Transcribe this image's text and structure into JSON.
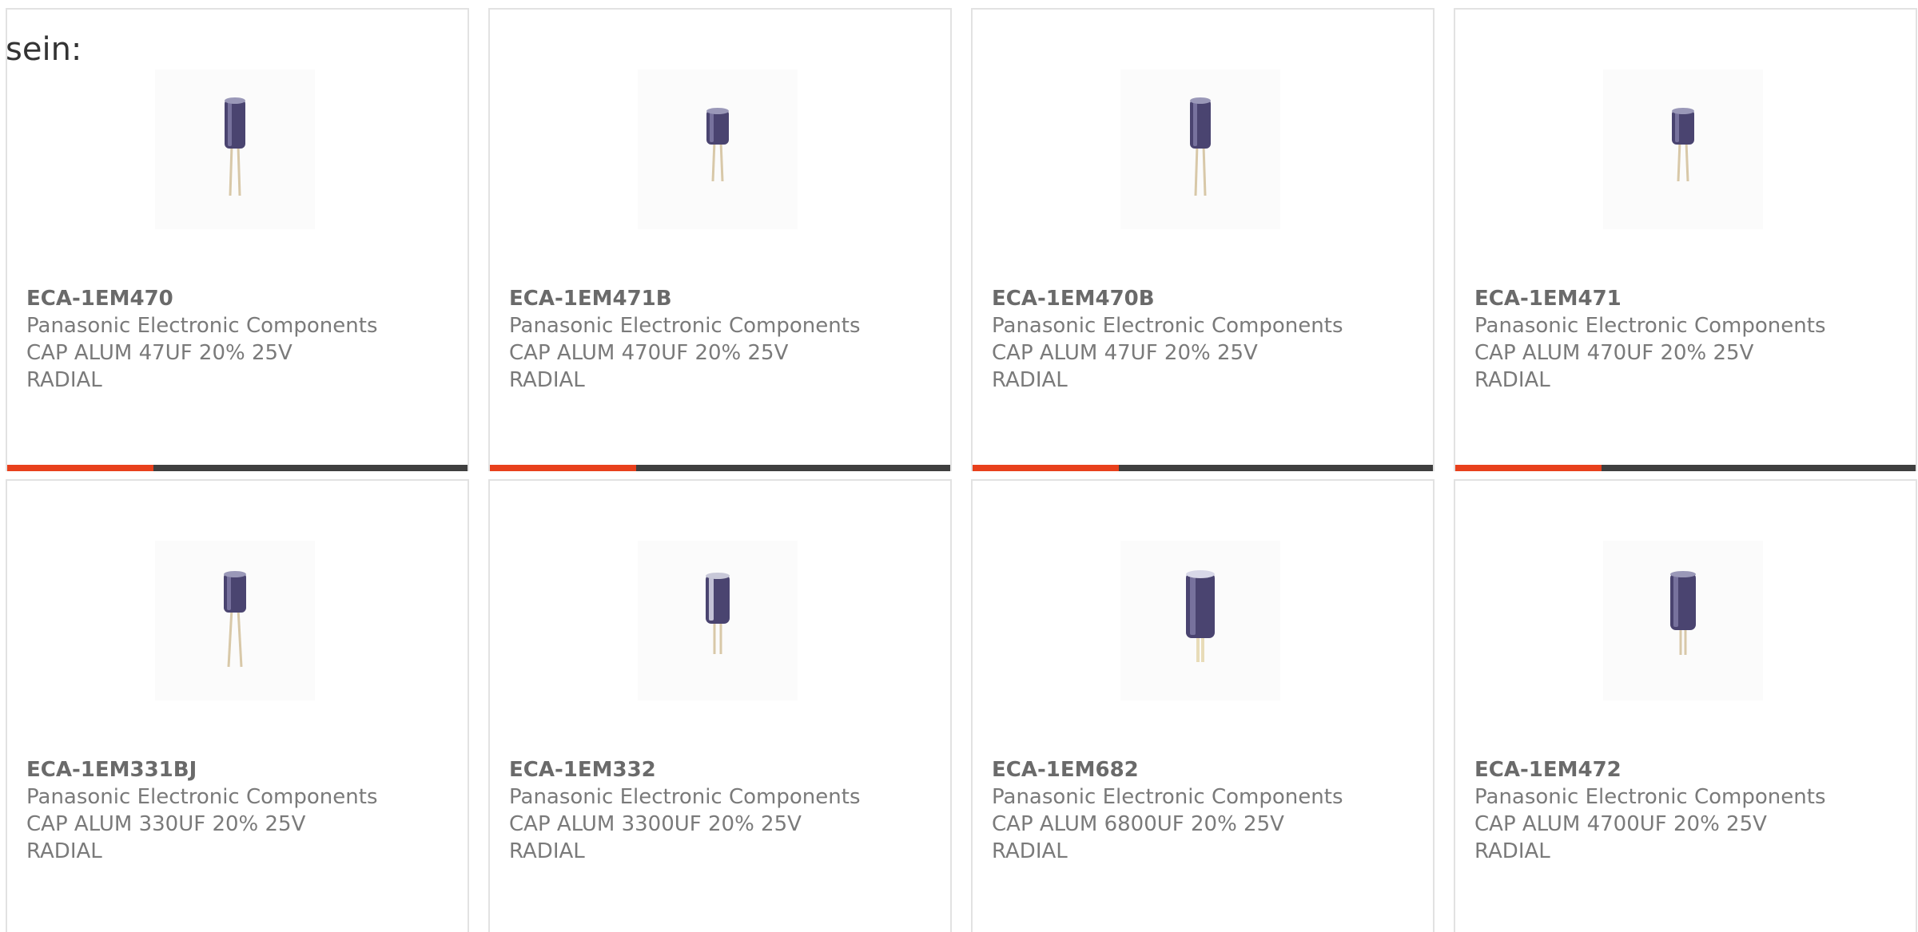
{
  "heading": "sein:",
  "accent_color": "#e8401c",
  "bar_color": "#3f3f3f",
  "cards": [
    {
      "part": "ECA-1EM470",
      "manufacturer": "Panasonic Electronic Components",
      "desc": "CAP ALUM 47UF 20% 25V",
      "mount": "RADIAL",
      "icon": "capacitor-icon"
    },
    {
      "part": "ECA-1EM471B",
      "manufacturer": "Panasonic Electronic Components",
      "desc": "CAP ALUM 470UF 20% 25V",
      "mount": "RADIAL",
      "icon": "capacitor-icon"
    },
    {
      "part": "ECA-1EM470B",
      "manufacturer": "Panasonic Electronic Components",
      "desc": "CAP ALUM 47UF 20% 25V",
      "mount": "RADIAL",
      "icon": "capacitor-icon"
    },
    {
      "part": "ECA-1EM471",
      "manufacturer": "Panasonic Electronic Components",
      "desc": "CAP ALUM 470UF 20% 25V",
      "mount": "RADIAL",
      "icon": "capacitor-icon"
    },
    {
      "part": "ECA-1EM331BJ",
      "manufacturer": "Panasonic Electronic Components",
      "desc": "CAP ALUM 330UF 20% 25V",
      "mount": "RADIAL",
      "icon": "capacitor-icon"
    },
    {
      "part": "ECA-1EM332",
      "manufacturer": "Panasonic Electronic Components",
      "desc": "CAP ALUM 3300UF 20% 25V",
      "mount": "RADIAL",
      "icon": "capacitor-icon"
    },
    {
      "part": "ECA-1EM682",
      "manufacturer": "Panasonic Electronic Components",
      "desc": "CAP ALUM 6800UF 20% 25V",
      "mount": "RADIAL",
      "icon": "capacitor-icon"
    },
    {
      "part": "ECA-1EM472",
      "manufacturer": "Panasonic Electronic Components",
      "desc": "CAP ALUM 4700UF 20% 25V",
      "mount": "RADIAL",
      "icon": "capacitor-icon"
    }
  ]
}
